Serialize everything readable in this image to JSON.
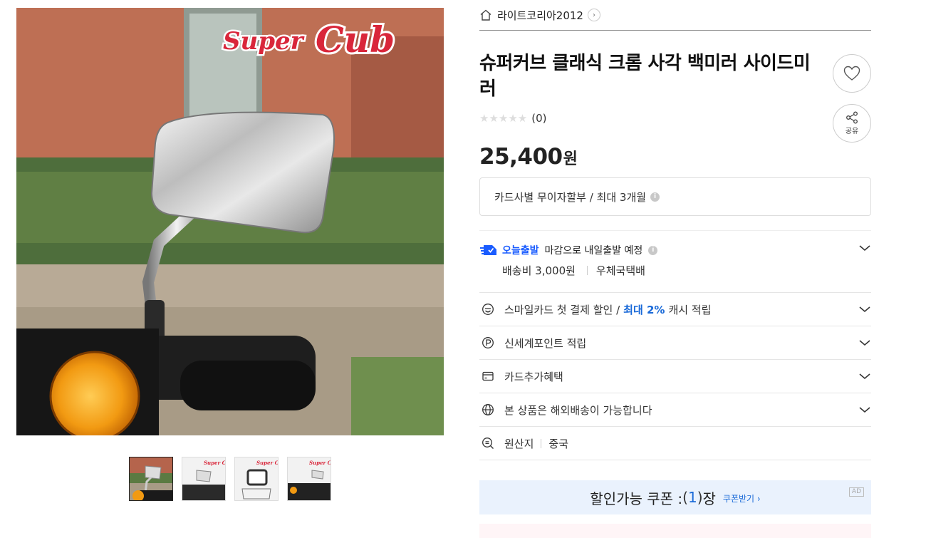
{
  "gallery": {
    "main_image_alt": "Super Cub chrome mirror",
    "brand_logo_text": "Super Cub",
    "thumbnails": [
      {
        "logo_text": "",
        "active": true
      },
      {
        "logo_text": "Super Cub",
        "active": false
      },
      {
        "logo_text": "Super Cub",
        "active": false
      },
      {
        "logo_text": "Super Cub",
        "active": false
      }
    ]
  },
  "seller": {
    "name": "라이트코리아2012",
    "icon": "home-icon"
  },
  "product": {
    "title": "슈퍼커브 클래식 크롬 사각 백미러 사이드미러",
    "rating_count": "(0)",
    "stars": "★★★★★",
    "price": "25,400",
    "currency": "원",
    "share_label": "공유"
  },
  "installment": {
    "text": "카드사별 무이자할부 / 최대 3개월",
    "info_icon": "i"
  },
  "delivery": {
    "badge": "오늘출발",
    "text": "마감으로 내일출발 예정",
    "fee": "배송비 3,000원",
    "carrier": "우체국택배"
  },
  "benefits": [
    {
      "icon": "smile-card-icon",
      "text": "스마일카드 첫 결제 할인 /",
      "highlight": "최대 2%",
      "suffix": "캐시 적립"
    },
    {
      "icon": "point-icon",
      "text": "신세계포인트 적립"
    },
    {
      "icon": "card-icon",
      "text": "카드추가혜택"
    },
    {
      "icon": "globe-icon",
      "text": "본 상품은 해외배송이 가능합니다"
    }
  ],
  "origin": {
    "label": "원산지",
    "value": "중국"
  },
  "coupon": {
    "prefix": "할인가능 쿠폰 : ",
    "open": "(",
    "count": "1",
    "close": ")",
    "suffix": "장",
    "get_label": "쿠폰받기 ›",
    "ad_label": "AD"
  },
  "colors": {
    "accent_blue": "#1a6ad8",
    "coupon_bg": "#eaf2fd",
    "logo_red": "#d9263a"
  }
}
